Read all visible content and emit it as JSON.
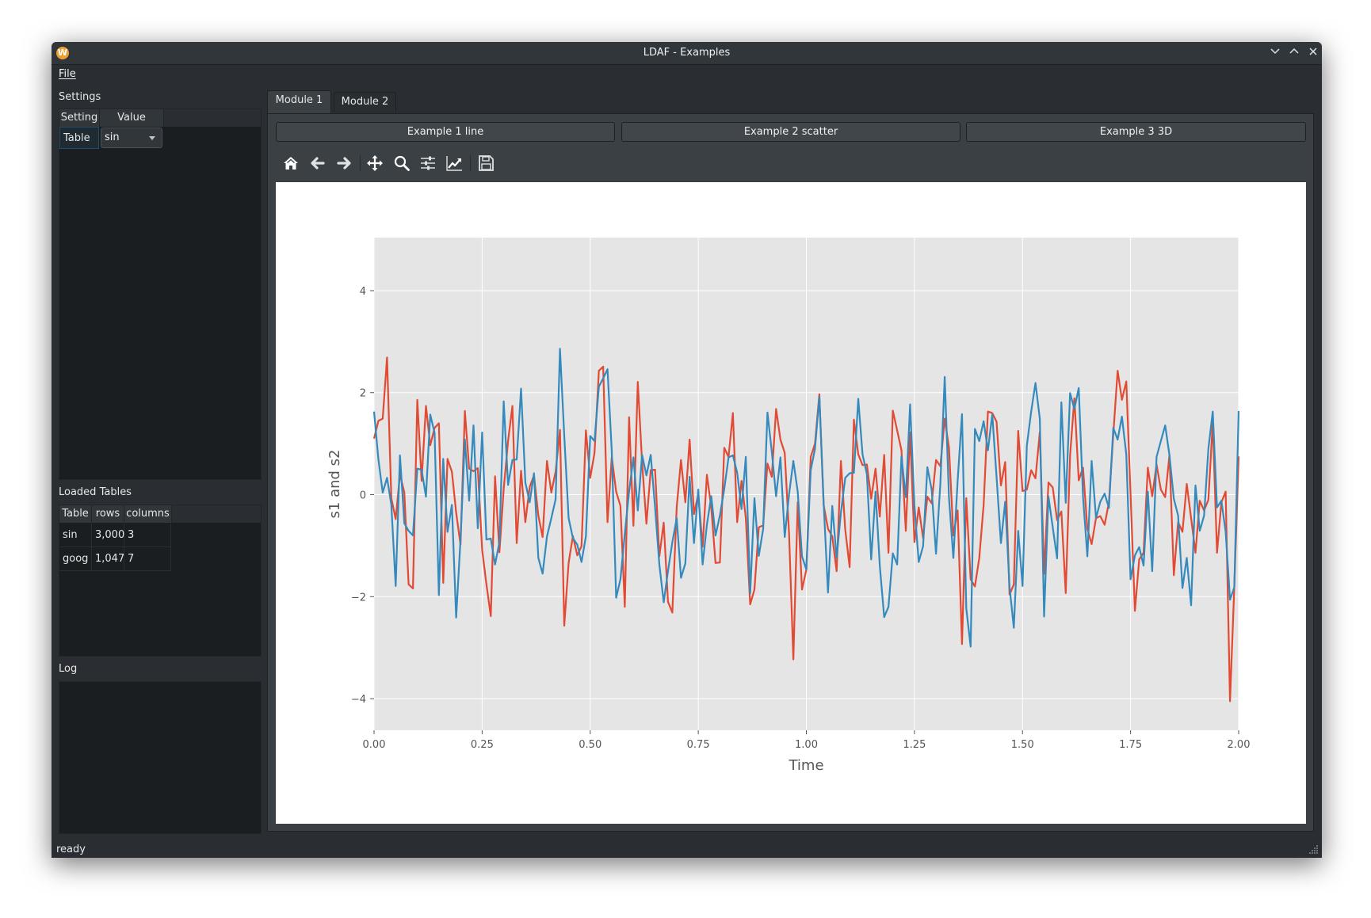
{
  "window": {
    "title": "LDAF - Examples",
    "app_icon_letter": "W",
    "controls": {
      "minimize": "⌄",
      "maximize": "⌃",
      "close": "✕"
    }
  },
  "menu": {
    "file": "File"
  },
  "settings": {
    "title": "Settings",
    "headers": [
      "Setting",
      "Value"
    ],
    "rows": [
      {
        "setting": "Table",
        "value": "sin"
      }
    ]
  },
  "loaded_tables": {
    "title": "Loaded Tables",
    "headers": [
      "Table",
      "rows",
      "columns"
    ],
    "rows": [
      {
        "table": "sin",
        "rows": "3,000",
        "columns": "3"
      },
      {
        "table": "goog",
        "rows": "1,047",
        "columns": "7"
      }
    ]
  },
  "log": {
    "title": "Log"
  },
  "status": {
    "text": "ready"
  },
  "tabs": [
    {
      "label": "Module 1",
      "active": true
    },
    {
      "label": "Module 2",
      "active": false
    }
  ],
  "buttons": [
    "Example 1 line",
    "Example 2 scatter",
    "Example 3 3D"
  ],
  "toolbar": [
    "home-icon",
    "back-icon",
    "forward-icon",
    "pan-icon",
    "zoom-icon",
    "configure-subplots-icon",
    "edit-axis-icon",
    "save-icon"
  ],
  "chart_data": {
    "type": "line",
    "title": "",
    "xlabel": "Time",
    "ylabel": "s1 and s2",
    "xlim": [
      0,
      2
    ],
    "ylim": [
      -4.62,
      5.04
    ],
    "xticks": [
      0,
      0.25,
      0.5,
      0.75,
      1.0,
      1.25,
      1.5,
      1.75,
      2.0
    ],
    "xtick_labels": [
      "0.00",
      "0.25",
      "0.50",
      "0.75",
      "1.00",
      "1.25",
      "1.50",
      "1.75",
      "2.00"
    ],
    "yticks": [
      -4,
      -2,
      0,
      2,
      4
    ],
    "ytick_labels": [
      "−4",
      "−2",
      "0",
      "2",
      "4"
    ],
    "grid": true,
    "style": "ggplot",
    "x_start": 0,
    "x_step": 0.01,
    "series": [
      {
        "name": "s1",
        "color": "#e24a33",
        "values": [
          1.1,
          1.45,
          1.49,
          2.69,
          -0.07,
          -0.48,
          0.4,
          0.04,
          -1.76,
          -1.84,
          1.86,
          0.27,
          1.74,
          0.97,
          1.31,
          1.4,
          -1.73,
          0.7,
          0.45,
          -0.35,
          -0.98,
          1.64,
          0.51,
          0.46,
          0.52,
          -1.08,
          -1.76,
          -2.38,
          0.36,
          -1.13,
          0.11,
          1.05,
          1.74,
          -0.95,
          0.47,
          -0.54,
          0.15,
          0.38,
          -0.41,
          -0.83,
          0.66,
          0.04,
          0.45,
          1.27,
          -2.57,
          -1.34,
          -0.81,
          -1.19,
          -1.01,
          1.26,
          0.33,
          0.82,
          2.43,
          2.51,
          -0.54,
          0.74,
          0.06,
          -0.22,
          -2.2,
          1.52,
          -0.61,
          2.21,
          0.64,
          -0.57,
          0.48,
          0.49,
          -1.21,
          -0.55,
          -2.1,
          -2.31,
          -0.25,
          0.68,
          -0.15,
          1.08,
          -0.38,
          0.01,
          -1.02,
          0.39,
          -0.25,
          -1.34,
          -1.33,
          0.92,
          0.74,
          1.6,
          -0.54,
          0.27,
          -0.46,
          -2.15,
          -1.86,
          -0.64,
          -0.6,
          0.61,
          0.35,
          1.68,
          1.08,
          0.82,
          -0.77,
          -3.23,
          -0.15,
          -1.86,
          -1.47,
          0.74,
          1.0,
          1.97,
          -0.2,
          -0.67,
          -0.82,
          -1.5,
          0.66,
          -0.69,
          -1.42,
          1.47,
          0.79,
          0.58,
          0.59,
          -0.08,
          0.51,
          -0.43,
          0.78,
          -1.14,
          1.65,
          1.26,
          0.87,
          -0.71,
          1.22,
          -0.93,
          -0.25,
          -0.85,
          -0.04,
          -0.17,
          0.68,
          0.56,
          1.49,
          0.92,
          -0.8,
          -0.31,
          -2.93,
          -0.07,
          -1.66,
          -1.8,
          -1.24,
          -0.2,
          1.63,
          1.6,
          1.43,
          0.18,
          0.64,
          -1.96,
          -1.76,
          1.25,
          0.07,
          0.1,
          0.48,
          0.32,
          1.23,
          -1.55,
          0.24,
          0.14,
          -0.5,
          -0.33,
          -1.93,
          0.77,
          1.89,
          0.28,
          0.53,
          -0.67,
          -0.97,
          -0.46,
          -0.42,
          -0.59,
          -0.15,
          1.18,
          2.43,
          1.86,
          2.22,
          0.01,
          -2.28,
          -1.27,
          -1.14,
          0.53,
          -0.03,
          0.59,
          0.1,
          -0.05,
          0.78,
          -1.58,
          -0.54,
          -0.73,
          0.21,
          -0.46,
          -1.14,
          -0.12,
          -0.31,
          -0.1,
          1.42,
          -1.14,
          -0.15,
          0.06,
          -4.05,
          -1.81,
          0.75
        ]
      },
      {
        "name": "s2",
        "color": "#348abd",
        "values": [
          1.63,
          0.69,
          0.04,
          0.33,
          -0.2,
          -1.79,
          0.77,
          -0.56,
          -0.71,
          -0.8,
          0.51,
          0.49,
          -0.04,
          1.57,
          1.21,
          -1.97,
          0.7,
          -0.73,
          -0.2,
          -2.41,
          -0.88,
          1.08,
          -0.12,
          1.36,
          -0.66,
          1.22,
          -0.88,
          -0.86,
          -1.37,
          -0.93,
          1.83,
          0.19,
          0.68,
          0.69,
          2.08,
          0.24,
          -0.15,
          0.42,
          -1.24,
          -1.55,
          -0.82,
          -0.46,
          -0.09,
          2.86,
          1.16,
          -0.46,
          -0.85,
          -0.98,
          -1.32,
          -0.82,
          1.15,
          1.05,
          2.12,
          2.28,
          2.46,
          0.84,
          -2.02,
          -1.66,
          -0.77,
          0.06,
          0.73,
          -0.31,
          0.78,
          0.38,
          0.78,
          -0.25,
          -1.37,
          -2.11,
          -1.5,
          -0.93,
          -0.46,
          -1.63,
          -1.35,
          0.35,
          -0.95,
          0.1,
          -1.37,
          -0.59,
          -0.03,
          -0.8,
          -0.41,
          0.11,
          0.73,
          0.77,
          0.43,
          -0.28,
          0.74,
          -1.94,
          -0.07,
          -1.2,
          -0.67,
          1.61,
          0.84,
          -0.03,
          0.73,
          -0.83,
          0.01,
          0.66,
          0.06,
          -1.21,
          -1.47,
          0.48,
          0.9,
          1.92,
          -0.15,
          -1.92,
          -0.22,
          -1.24,
          -0.35,
          0.33,
          0.42,
          0.43,
          1.88,
          0.79,
          0.4,
          -1.27,
          0.06,
          -1.4,
          -2.4,
          -2.2,
          -1.15,
          -1.37,
          0.75,
          -0.05,
          1.77,
          -0.22,
          -1.32,
          -1.01,
          0.54,
          0.09,
          -1.16,
          0.22,
          2.31,
          -0.07,
          -1.24,
          0.27,
          1.58,
          -2.23,
          -2.98,
          1.29,
          1.05,
          1.44,
          0.87,
          1.57,
          0.35,
          -0.95,
          -0.14,
          -1.81,
          -2.61,
          -0.71,
          -1.79,
          0.96,
          1.63,
          2.19,
          1.49,
          -2.39,
          -0.04,
          -0.64,
          -1.25,
          1.81,
          -0.16,
          1.99,
          1.68,
          2.09,
          -0.04,
          -1.21,
          0.66,
          -0.46,
          -0.14,
          0.02,
          -0.26,
          1.31,
          1.08,
          1.53,
          0.79,
          -1.66,
          -1.19,
          -1.03,
          -1.39,
          0.06,
          -1.5,
          0.74,
          1.05,
          1.36,
          0.77,
          -0.08,
          -0.41,
          -1.83,
          -1.24,
          -2.17,
          0.18,
          -0.71,
          -0.41,
          0.9,
          1.63,
          -0.25,
          -0.12,
          -0.73,
          -2.06,
          -1.82,
          1.64
        ]
      }
    ]
  }
}
